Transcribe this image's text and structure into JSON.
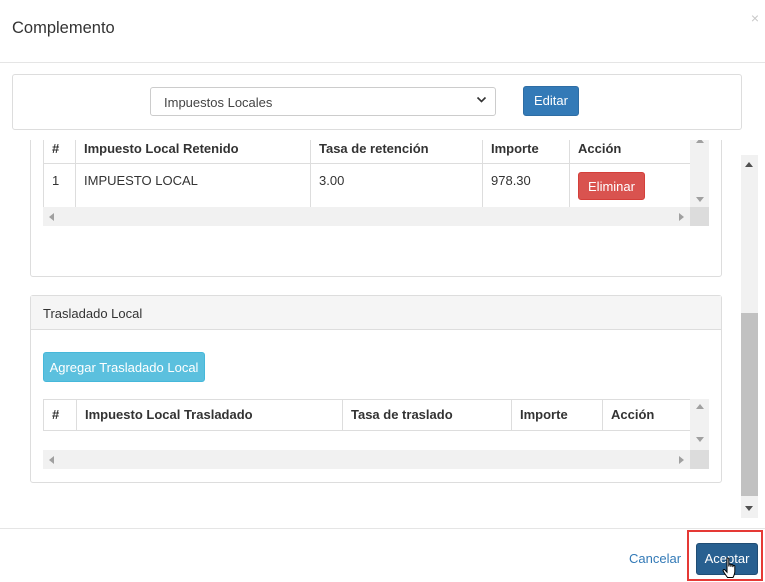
{
  "modal": {
    "title": "Complemento",
    "close": "×"
  },
  "selector": {
    "selected": "Impuestos Locales",
    "edit_label": "Editar"
  },
  "retenido": {
    "columns": [
      "#",
      "Impuesto Local Retenido",
      "Tasa de retención",
      "Importe",
      "Acción"
    ],
    "rows": [
      {
        "num": "1",
        "impuesto": "IMPUESTO LOCAL",
        "tasa": "3.00",
        "importe": "978.30",
        "accion": "Eliminar"
      }
    ]
  },
  "trasladado": {
    "heading": "Trasladado Local",
    "add_label": "Agregar Trasladado Local",
    "columns": [
      "#",
      "Impuesto Local Trasladado",
      "Tasa de traslado",
      "Importe",
      "Acción"
    ]
  },
  "footer": {
    "cancel_label": "Cancelar",
    "accept_label": "Aceptar"
  },
  "colors": {
    "primary": "#337ab7",
    "danger": "#d9534f",
    "info": "#5bc0de",
    "highlight": "#e53935"
  }
}
